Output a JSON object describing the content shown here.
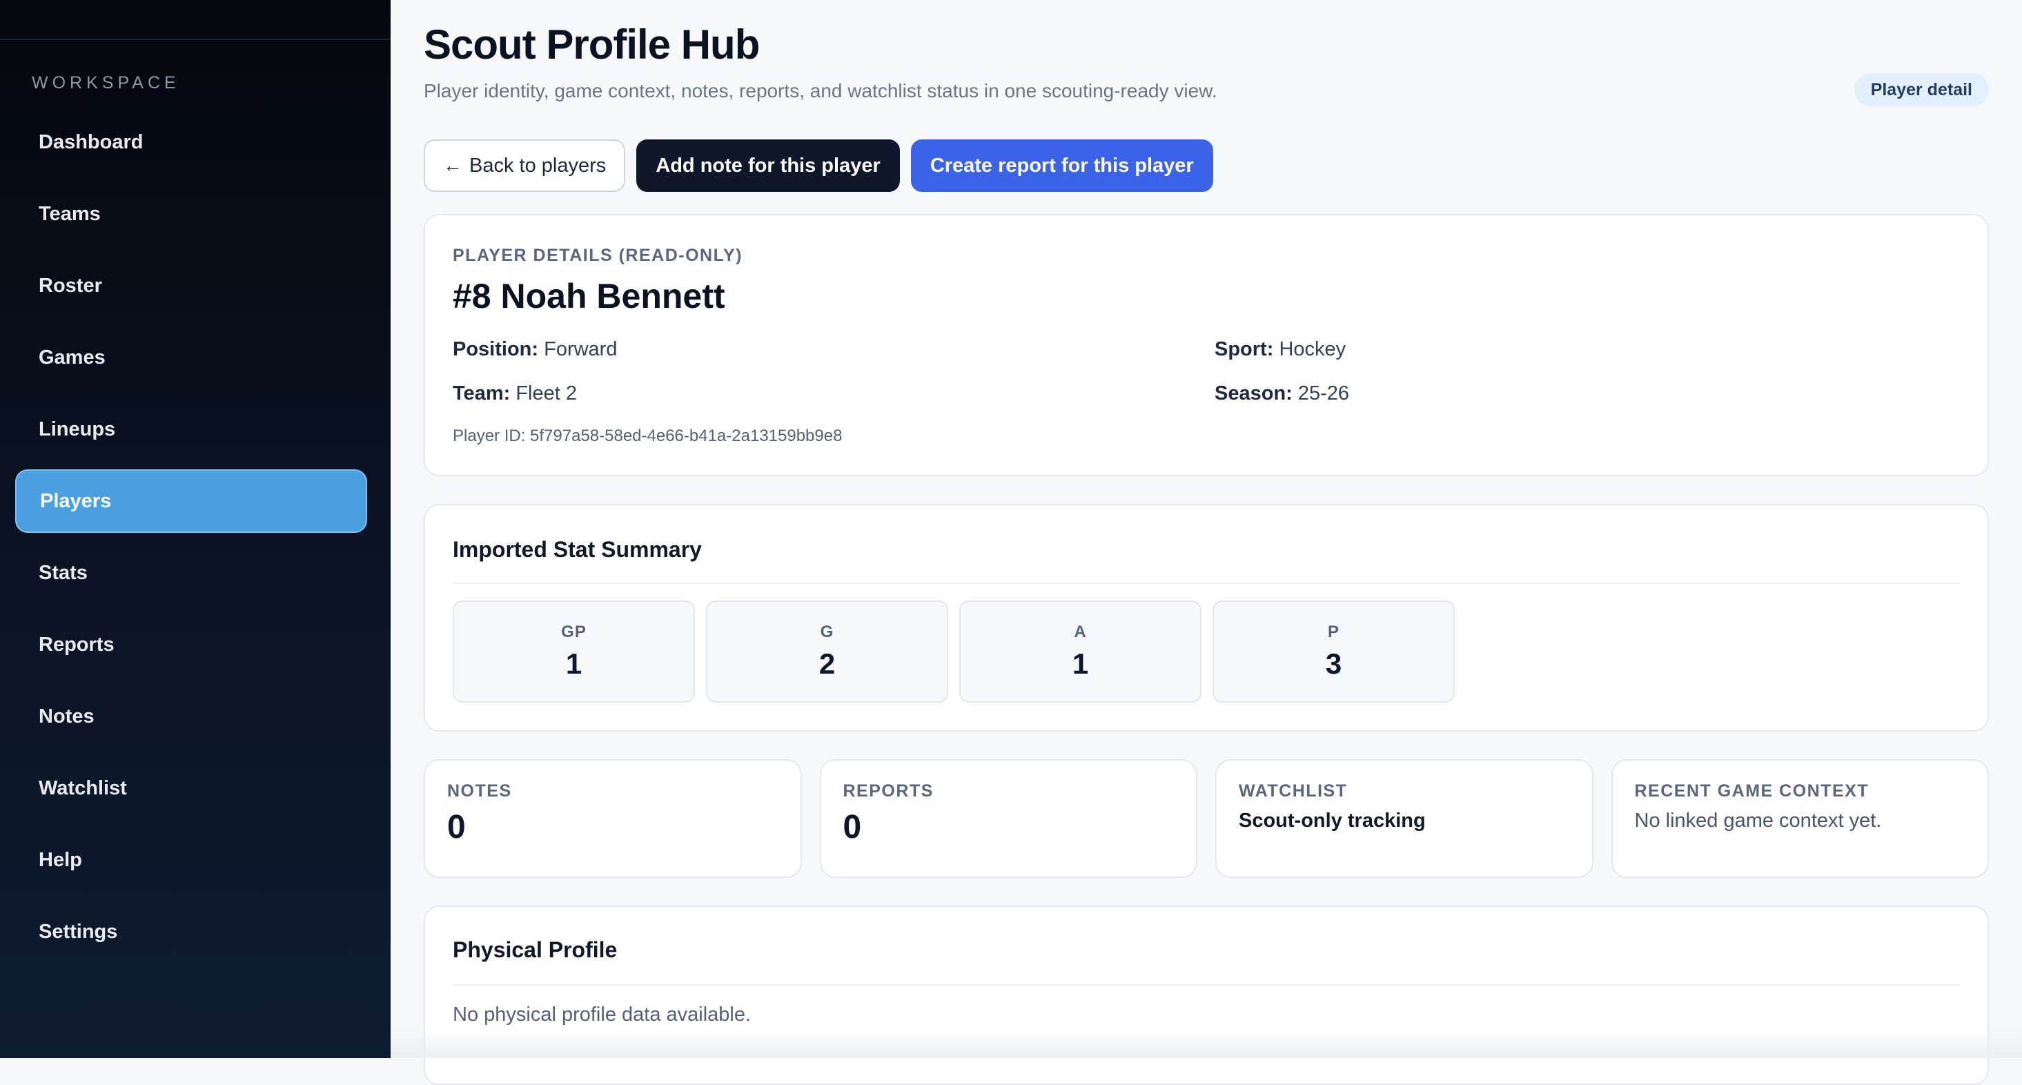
{
  "sidebar": {
    "section_label": "WORKSPACE",
    "items": [
      {
        "label": "Dashboard"
      },
      {
        "label": "Teams"
      },
      {
        "label": "Roster"
      },
      {
        "label": "Games"
      },
      {
        "label": "Lineups"
      },
      {
        "label": "Players",
        "active": true
      },
      {
        "label": "Stats"
      },
      {
        "label": "Reports"
      },
      {
        "label": "Notes"
      },
      {
        "label": "Watchlist"
      },
      {
        "label": "Help"
      },
      {
        "label": "Settings"
      }
    ]
  },
  "header": {
    "title": "Scout Profile Hub",
    "subtitle": "Player identity, game context, notes, reports, and watchlist status in one scouting-ready view.",
    "badge": "Player detail"
  },
  "actions": {
    "back_label": "Back to players",
    "back_icon": "arrow-left-icon",
    "add_note_label": "Add note for this player",
    "create_report_label": "Create report for this player"
  },
  "player": {
    "eyebrow": "PLAYER DETAILS (READ-ONLY)",
    "name": "#8 Noah Bennett",
    "position_label": "Position:",
    "position": "Forward",
    "team_label": "Team:",
    "team": "Fleet 2",
    "sport_label": "Sport:",
    "sport": "Hockey",
    "season_label": "Season:",
    "season": "25-26",
    "player_id": "Player ID: 5f797a58-58ed-4e66-b41a-2a13159bb9e8"
  },
  "stats": {
    "heading": "Imported Stat Summary",
    "tiles": [
      {
        "label": "GP",
        "value": "1"
      },
      {
        "label": "G",
        "value": "2"
      },
      {
        "label": "A",
        "value": "1"
      },
      {
        "label": "P",
        "value": "3"
      }
    ]
  },
  "summary": {
    "notes_label": "NOTES",
    "notes_value": "0",
    "reports_label": "REPORTS",
    "reports_value": "0",
    "watchlist_label": "WATCHLIST",
    "watchlist_value": "Scout-only tracking",
    "recent_label": "RECENT GAME CONTEXT",
    "recent_value": "No linked game context yet."
  },
  "physical": {
    "heading": "Physical Profile",
    "empty": "No physical profile data available."
  },
  "colors": {
    "sidebar_bg": "#0b1424",
    "active_nav": "#4a9fe0",
    "primary_button": "#3b63e8",
    "dark_button": "#0f172a",
    "badge_bg": "#e3f0fb"
  }
}
